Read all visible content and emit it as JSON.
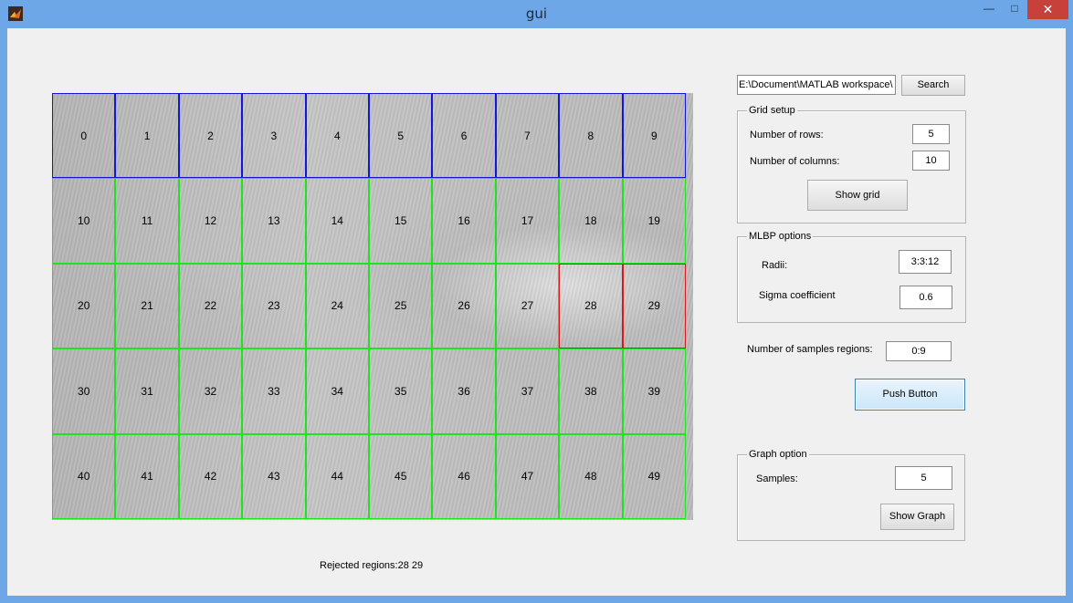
{
  "window": {
    "title": "gui",
    "app_icon": "matlab-icon"
  },
  "image_grid": {
    "cells": [
      "0",
      "1",
      "2",
      "3",
      "4",
      "5",
      "6",
      "7",
      "8",
      "9",
      "10",
      "11",
      "12",
      "13",
      "14",
      "15",
      "16",
      "17",
      "18",
      "19",
      "20",
      "21",
      "22",
      "23",
      "24",
      "25",
      "26",
      "27",
      "28",
      "29",
      "30",
      "31",
      "32",
      "33",
      "34",
      "35",
      "36",
      "37",
      "38",
      "39",
      "40",
      "41",
      "42",
      "43",
      "44",
      "45",
      "46",
      "47",
      "48",
      "49"
    ],
    "colors": {
      "sample": "#1515d8",
      "normal": "#1ee31e",
      "rejected": "#d41a1a"
    }
  },
  "rejected": {
    "text": "Rejected regions:28  29"
  },
  "path": {
    "value": "E:\\Document\\MATLAB workspace\\"
  },
  "search_button": "Search",
  "grid_setup": {
    "title": "Grid setup",
    "rows_label": "Number of rows:",
    "rows_value": "5",
    "cols_label": "Number of columns:",
    "cols_value": "10",
    "show_grid_button": "Show grid"
  },
  "mlbp": {
    "title": "MLBP options",
    "radii_label": "Radii:",
    "radii_value": "3:3:12",
    "sigma_label": "Sigma coefficient",
    "sigma_value": "0.6"
  },
  "samples_regions": {
    "label": "Number of samples regions:",
    "value": "0:9"
  },
  "push_button": "Push Button",
  "graph": {
    "title": "Graph option",
    "samples_label": "Samples:",
    "samples_value": "5",
    "show_graph_button": "Show Graph"
  }
}
